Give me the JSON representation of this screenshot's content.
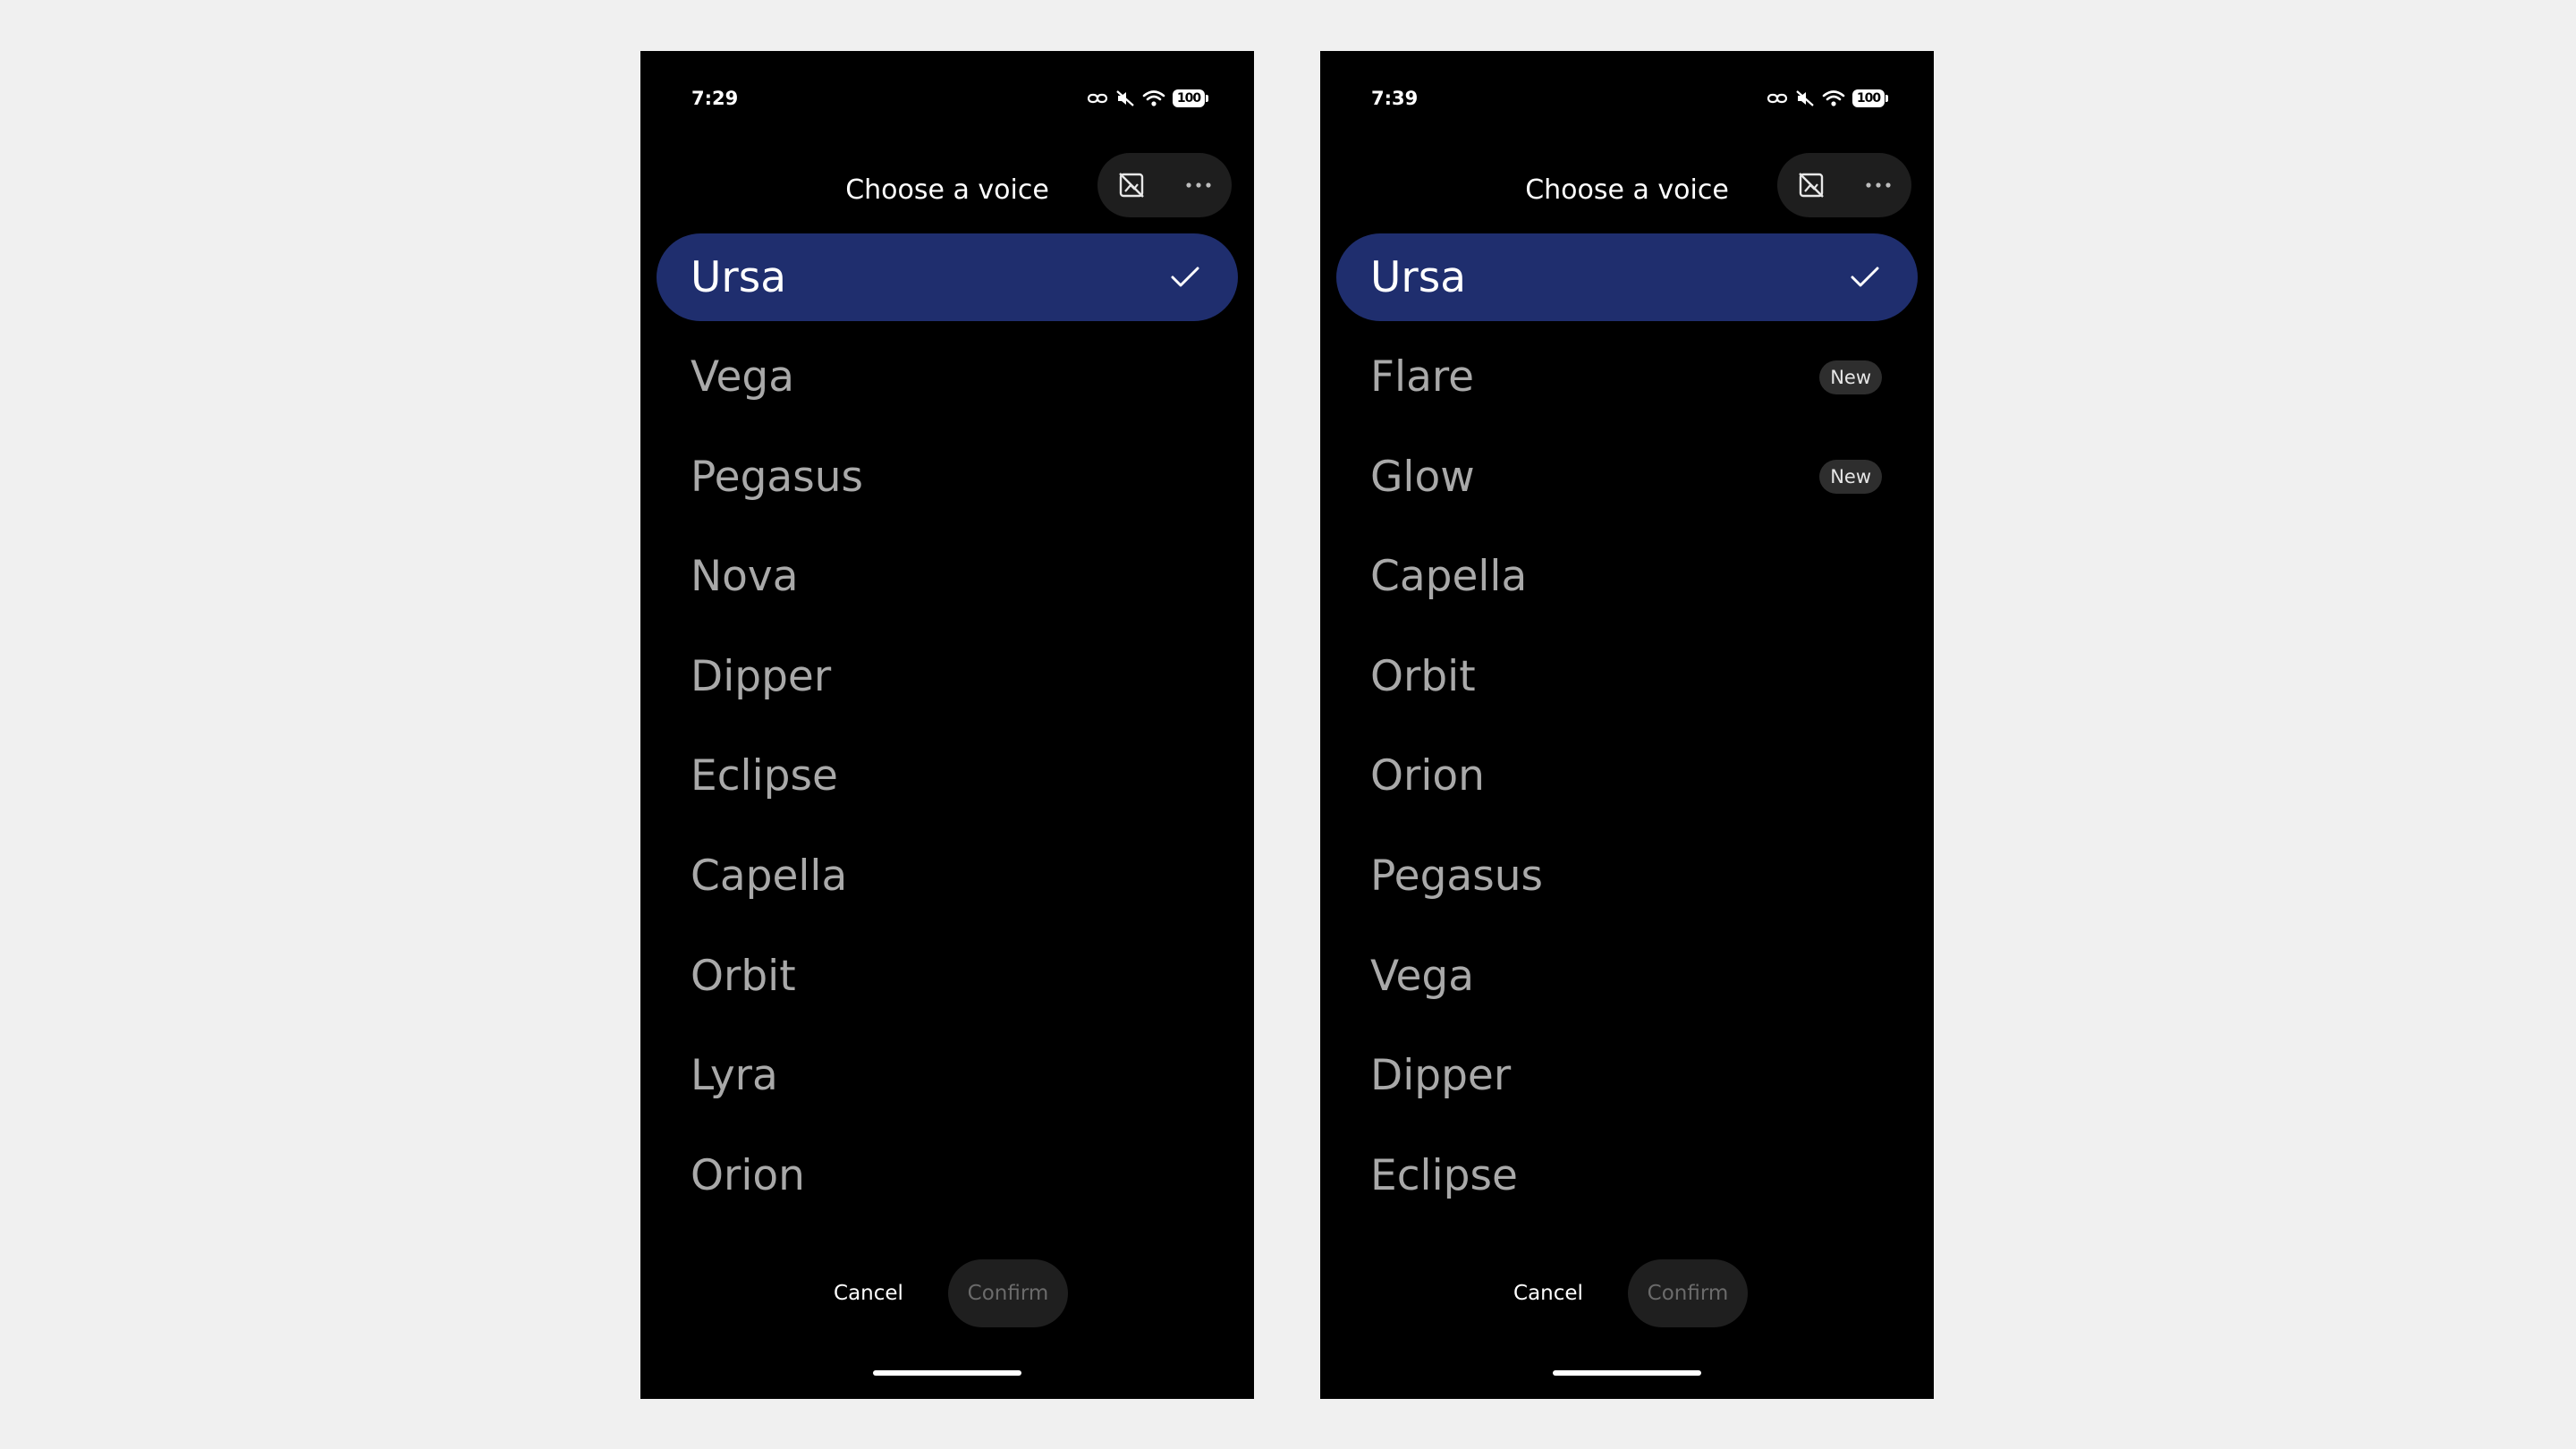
{
  "left": {
    "status": {
      "time": "7:29",
      "battery": "100"
    },
    "header": {
      "title": "Choose a voice",
      "no_screen_icon": "screen-share-off-icon",
      "more_icon": "more-horizontal-icon"
    },
    "voices": [
      {
        "name": "Ursa",
        "selected": true,
        "badge": ""
      },
      {
        "name": "Vega",
        "selected": false,
        "badge": ""
      },
      {
        "name": "Pegasus",
        "selected": false,
        "badge": ""
      },
      {
        "name": "Nova",
        "selected": false,
        "badge": ""
      },
      {
        "name": "Dipper",
        "selected": false,
        "badge": ""
      },
      {
        "name": "Eclipse",
        "selected": false,
        "badge": ""
      },
      {
        "name": "Capella",
        "selected": false,
        "badge": ""
      },
      {
        "name": "Orbit",
        "selected": false,
        "badge": ""
      },
      {
        "name": "Lyra",
        "selected": false,
        "badge": ""
      },
      {
        "name": "Orion",
        "selected": false,
        "badge": ""
      }
    ],
    "footer": {
      "cancel_label": "Cancel",
      "confirm_label": "Confirm"
    }
  },
  "right": {
    "status": {
      "time": "7:39",
      "battery": "100"
    },
    "header": {
      "title": "Choose a voice",
      "no_screen_icon": "screen-share-off-icon",
      "more_icon": "more-horizontal-icon"
    },
    "voices": [
      {
        "name": "Ursa",
        "selected": true,
        "badge": ""
      },
      {
        "name": "Flare",
        "selected": false,
        "badge": "New"
      },
      {
        "name": "Glow",
        "selected": false,
        "badge": "New"
      },
      {
        "name": "Capella",
        "selected": false,
        "badge": ""
      },
      {
        "name": "Orbit",
        "selected": false,
        "badge": ""
      },
      {
        "name": "Orion",
        "selected": false,
        "badge": ""
      },
      {
        "name": "Pegasus",
        "selected": false,
        "badge": ""
      },
      {
        "name": "Vega",
        "selected": false,
        "badge": ""
      },
      {
        "name": "Dipper",
        "selected": false,
        "badge": ""
      },
      {
        "name": "Eclipse",
        "selected": false,
        "badge": ""
      }
    ],
    "footer": {
      "cancel_label": "Cancel",
      "confirm_label": "Confirm"
    }
  },
  "colors": {
    "page_background": "#f0f0f0",
    "phone_background": "#000000",
    "selected_background": "#1f2e6e",
    "unselected_text": "#a9a9a9",
    "badge_background": "#2e2e2e",
    "confirm_disabled_text": "#6b6b6b"
  }
}
